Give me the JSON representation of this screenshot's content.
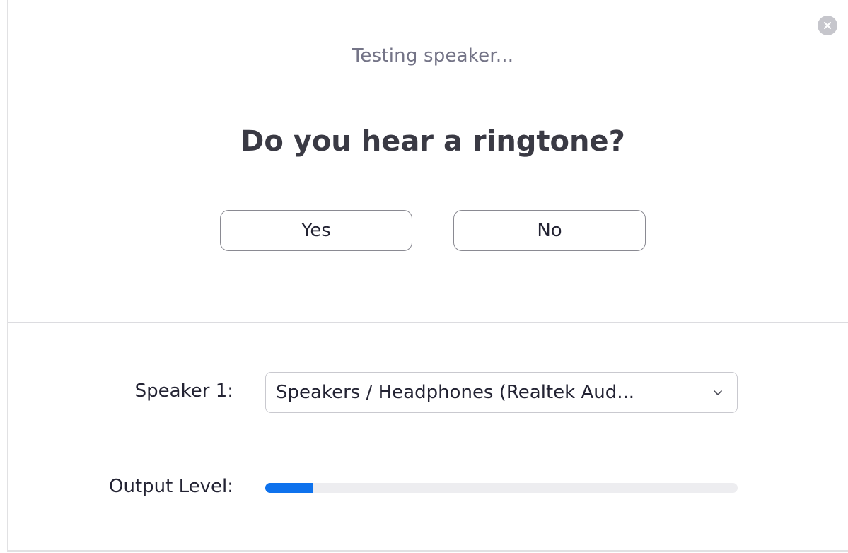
{
  "dialog": {
    "status_text": "Testing speaker...",
    "question": "Do you hear a ringtone?",
    "close_icon": "close-icon"
  },
  "buttons": {
    "yes_label": "Yes",
    "no_label": "No"
  },
  "speaker": {
    "label": "Speaker 1:",
    "selected_value": "Speakers / Headphones (Realtek Aud...",
    "dropdown_icon": "chevron-down-icon"
  },
  "output": {
    "label": "Output Level:",
    "level_fraction": 0.1
  },
  "colors": {
    "accent": "#0e72ed",
    "heading": "#3a3a44",
    "muted_text": "#747487",
    "close_button": "#c6c6cc"
  }
}
